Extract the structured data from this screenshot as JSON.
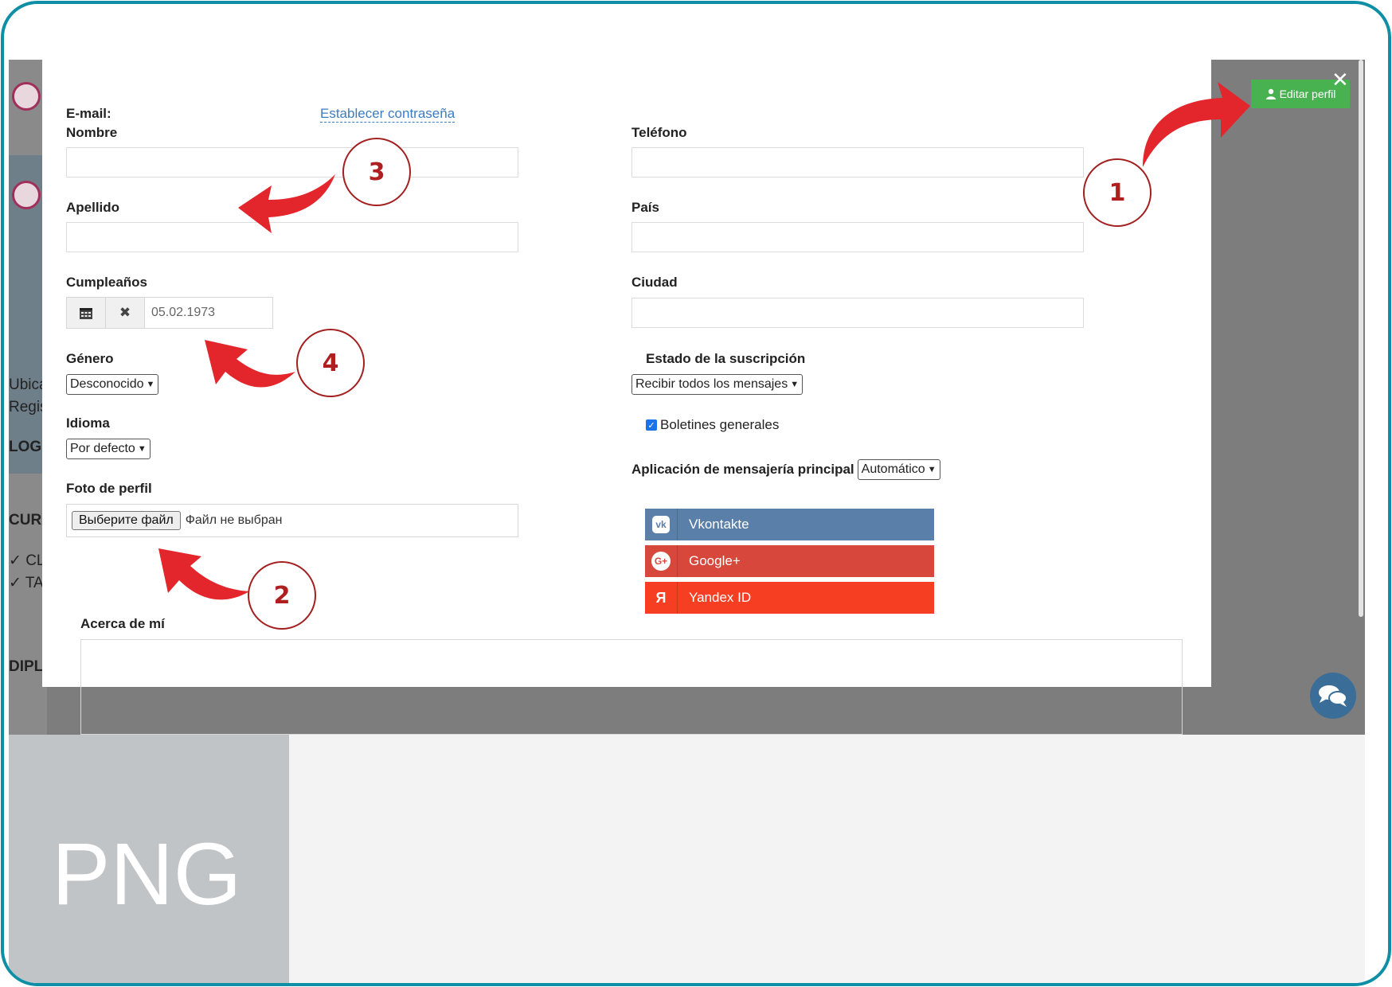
{
  "form": {
    "email_label": "E-mail:",
    "set_password_link": "Establecer contraseña",
    "nombre_label": "Nombre",
    "nombre_value": "",
    "apellido_label": "Apellido",
    "apellido_value": "",
    "cumpleanos_label": "Cumpleaños",
    "cumpleanos_value": "05.02.1973",
    "genero_label": "Género",
    "genero_value": "Desconocido",
    "idioma_label": "Idioma",
    "idioma_value": "Por defecto",
    "foto_label": "Foto de perfil",
    "file_button": "Выберите файл",
    "file_status": "Файл не выбран",
    "acerca_label": "Acerca de mí",
    "telefono_label": "Teléfono",
    "pais_label": "País",
    "ciudad_label": "Ciudad",
    "suscripcion_label": "Estado de la suscripción",
    "suscripcion_value": "Recibir todos los mensajes",
    "boletines_label": "Boletines generales",
    "boletines_checked": true,
    "mensajeria_label": "Aplicación de mensajería principal",
    "mensajeria_value": "Automático"
  },
  "social": [
    {
      "label": "Vkontakte",
      "icon": "vk-icon",
      "color": "#5a7fa8"
    },
    {
      "label": "Google+",
      "icon": "google-plus-icon",
      "color": "#d8473b"
    },
    {
      "label": "Yandex ID",
      "icon": "yandex-icon",
      "color": "#f53e22"
    }
  ],
  "header": {
    "edit_profile_label": "Editar perfil",
    "close_icon": "close-icon"
  },
  "background_page": {
    "snippets": [
      "Ubicac",
      "Regist",
      "LOGR",
      "CURS",
      "✓ CLA",
      "✓ TAL",
      "DIPLO"
    ]
  },
  "annotations": {
    "callouts": [
      "1",
      "2",
      "3",
      "4"
    ],
    "accent_color": "#e3262c"
  },
  "watermark": {
    "label": "PNG"
  },
  "colors": {
    "frame_border": "#0e8fa5",
    "edit_button": "#47b24f",
    "chat_button": "#3a6e98"
  }
}
